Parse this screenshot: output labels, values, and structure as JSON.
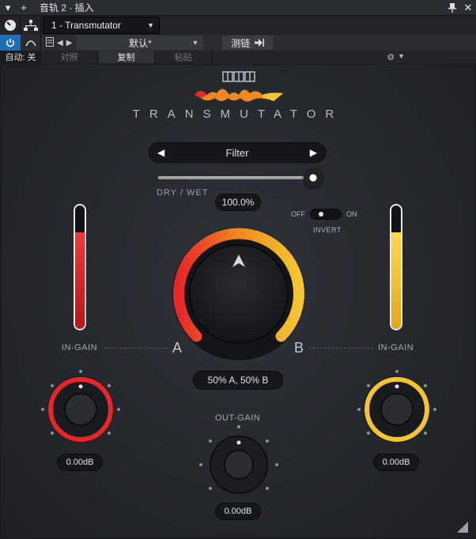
{
  "window": {
    "title": "音轨 2 · 插入",
    "plugin_name": "1 - Transmutator"
  },
  "toolbar": {
    "preset_name": "默认*",
    "compare_label": "测链",
    "auto_label": "自动: 关",
    "compare_a": "对照",
    "copy_label": "复制",
    "paste_label": "粘贴"
  },
  "plugin": {
    "logo_text": "TRANSMUTATOR",
    "filter_label": "Filter",
    "dry_wet_label": "DRY / WET",
    "dry_wet_value": "100.0%",
    "dry_wet_fraction": 1.0,
    "invert_off": "OFF",
    "invert_on": "ON",
    "invert_label": "INVERT",
    "invert_state": "off",
    "morph_value": "50% A, 50% B",
    "morph_fraction": 0.5,
    "label_a": "A",
    "label_b": "B",
    "in_gain_a_label": "IN-GAIN",
    "in_gain_b_label": "IN-GAIN",
    "out_gain_label": "OUT-GAIN",
    "in_gain_a_value": "0.00dB",
    "in_gain_b_value": "0.00dB",
    "out_gain_value": "0.00dB",
    "meter_a_level": 0.78,
    "meter_b_level": 0.78
  },
  "colors": {
    "accent_red": "#e8262a",
    "accent_yellow": "#f2c531",
    "accent_orange": "#f08a20",
    "power_blue": "#1e6fb8"
  }
}
